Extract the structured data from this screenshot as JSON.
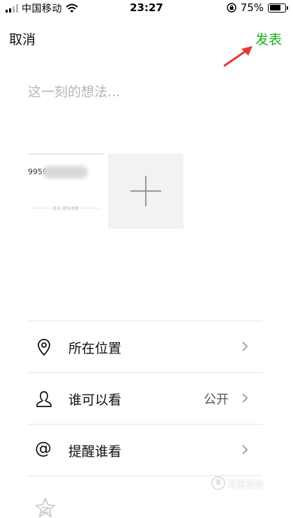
{
  "status_bar": {
    "carrier": "中国移动",
    "time": "23:27",
    "battery_percent": "75%",
    "battery_level": 0.75,
    "icons": [
      "signal-icon",
      "wifi-icon",
      "orientation-lock-icon",
      "battery-icon"
    ]
  },
  "nav": {
    "cancel_label": "取消",
    "publish_label": "发表",
    "publish_color": "#1aad19"
  },
  "compose": {
    "placeholder": "这一刻的想法..."
  },
  "attachment": {
    "thumbnail_text": "9959",
    "thumbnail_footer": "来自 微信收藏",
    "add_icon": "plus-icon"
  },
  "options": [
    {
      "icon": "location-pin-icon",
      "label": "所在位置",
      "value": ""
    },
    {
      "icon": "person-icon",
      "label": "谁可以看",
      "value": "公开"
    },
    {
      "icon": "at-icon",
      "label": "提醒谁看",
      "value": ""
    }
  ],
  "colors": {
    "accent_green": "#1aad19",
    "annotation_arrow": "#e53935",
    "divider": "#e5e5e5"
  },
  "watermark": {
    "text": "百度经验"
  }
}
